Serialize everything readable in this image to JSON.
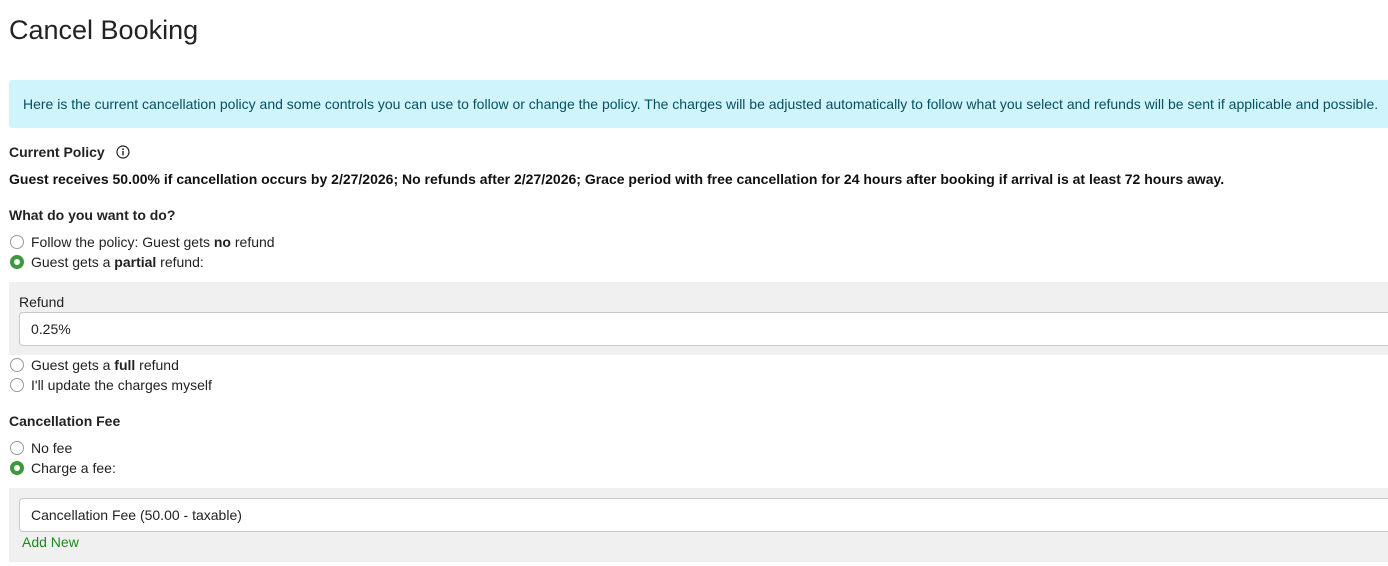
{
  "page": {
    "title": "Cancel Booking"
  },
  "alert": {
    "text": "Here is the current cancellation policy and some controls you can use to follow or change the policy. The charges will be adjusted automatically to follow what you select and refunds will be sent if applicable and possible."
  },
  "current_policy": {
    "heading": "Current Policy",
    "icon": "info-circle-icon",
    "text": "Guest receives 50.00% if cancellation occurs by 2/27/2026; No refunds after 2/27/2026; Grace period with free cancellation for 24 hours after booking if arrival is at least 72 hours away."
  },
  "refund_options": {
    "heading": "What do you want to do?",
    "options": [
      {
        "before": "Follow the policy: Guest gets ",
        "bold": "no",
        "after": " refund",
        "checked": false
      },
      {
        "before": "Guest gets a ",
        "bold": "partial",
        "after": " refund:",
        "checked": true
      },
      {
        "before": "Guest gets a ",
        "bold": "full",
        "after": " refund",
        "checked": false
      },
      {
        "before": "I'll update the charges myself",
        "bold": "",
        "after": "",
        "checked": false
      }
    ],
    "refund_field": {
      "label": "Refund",
      "value": "0.25%"
    }
  },
  "cancellation_fee": {
    "heading": "Cancellation Fee",
    "options": [
      {
        "label": "No fee",
        "checked": false
      },
      {
        "label": "Charge a fee:",
        "checked": true
      }
    ],
    "fee_select": {
      "value": "Cancellation Fee (50.00 - taxable)"
    },
    "add_new_label": "Add New"
  },
  "colors": {
    "alert_bg": "#cff4fc",
    "alert_text": "#055160",
    "panel_bg": "#f0f0f0",
    "radio_checked": "#3c9a3c",
    "link": "#1e8a1e"
  }
}
